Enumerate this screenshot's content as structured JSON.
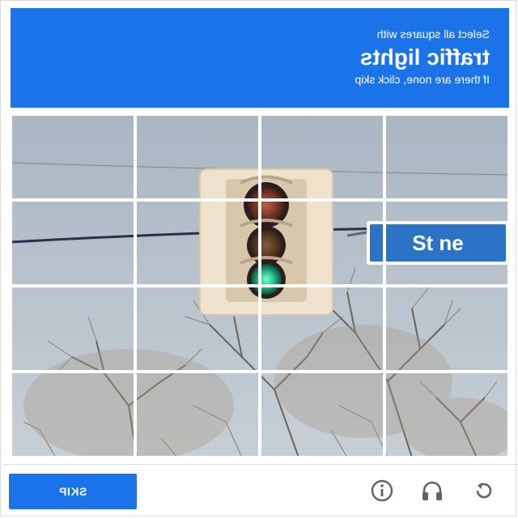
{
  "header": {
    "line1": "Select all squares with",
    "target": "traffic lights",
    "line3": "If there are none, click skip"
  },
  "grid": {
    "rows": 4,
    "cols": 4,
    "street_sign_text": "St ne"
  },
  "footer": {
    "verify_label": "SKIP"
  },
  "icons": {
    "reload": "reload-icon",
    "audio": "headphones-icon",
    "info": "info-icon"
  },
  "colors": {
    "accent": "#1a73e8"
  }
}
